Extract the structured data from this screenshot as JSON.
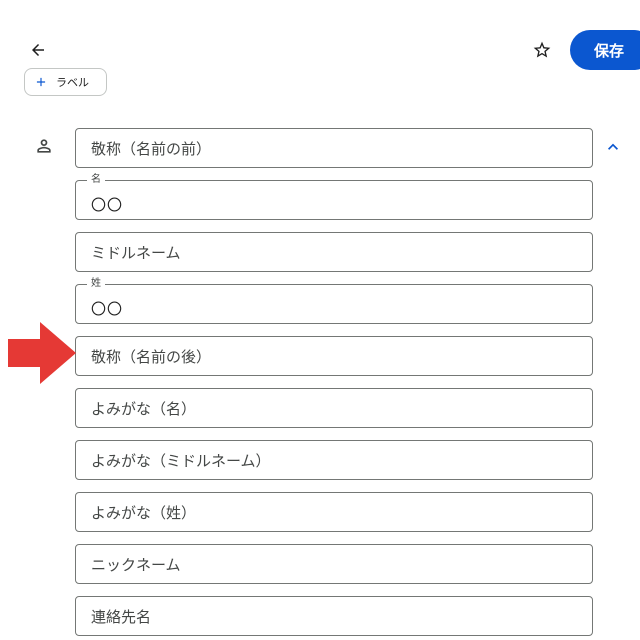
{
  "header": {
    "back_icon": "arrow-back-icon",
    "star_icon": "star-outline-icon",
    "save_label": "保存"
  },
  "label_chip": {
    "icon": "plus-icon",
    "text": "ラベル"
  },
  "name_section": {
    "icon": "person-icon",
    "collapse_icon": "chevron-up-icon",
    "fields": [
      {
        "placeholder": "敬称（名前の前）",
        "label": "",
        "value": ""
      },
      {
        "placeholder": "",
        "label": "名",
        "value": "〇〇"
      },
      {
        "placeholder": "ミドルネーム",
        "label": "",
        "value": ""
      },
      {
        "placeholder": "",
        "label": "姓",
        "value": "〇〇"
      },
      {
        "placeholder": "敬称（名前の後）",
        "label": "",
        "value": ""
      },
      {
        "placeholder": "よみがな（名）",
        "label": "",
        "value": ""
      },
      {
        "placeholder": "よみがな（ミドルネーム）",
        "label": "",
        "value": ""
      },
      {
        "placeholder": "よみがな（姓）",
        "label": "",
        "value": ""
      },
      {
        "placeholder": "ニックネーム",
        "label": "",
        "value": ""
      },
      {
        "placeholder": "連絡先名",
        "label": "",
        "value": ""
      }
    ]
  },
  "annotation": {
    "icon": "red-arrow-icon",
    "color": "#e53935"
  },
  "colors": {
    "accent": "#0b57d0",
    "icon": "#444746",
    "outline": "#747775"
  }
}
